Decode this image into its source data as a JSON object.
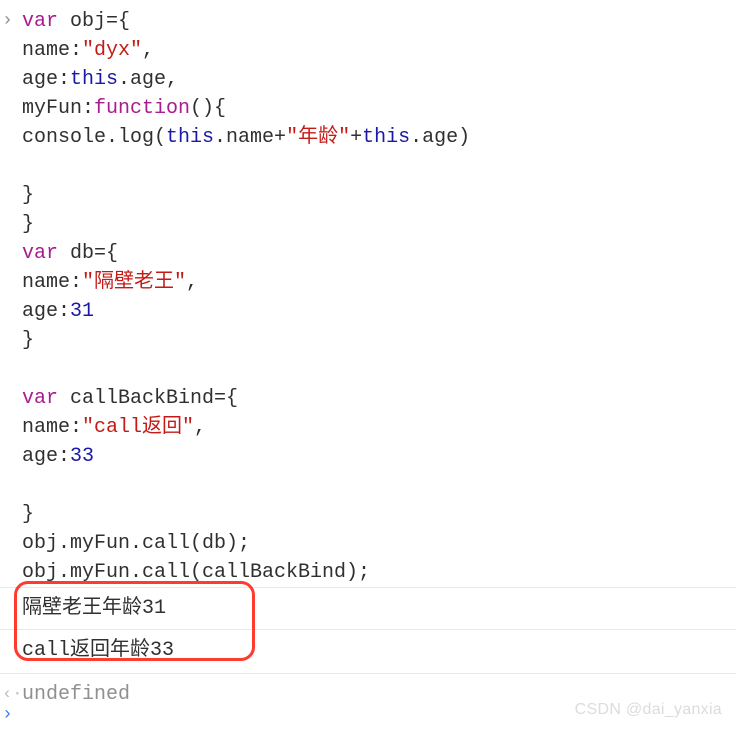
{
  "code": {
    "l1": {
      "a": "var",
      "b": " obj={"
    },
    "l2": {
      "a": "name:",
      "b": "\"dyx\"",
      "c": ","
    },
    "l3": {
      "a": "age:",
      "b": "this",
      "c": ".age,"
    },
    "l4": {
      "a": "myFun:",
      "b": "function",
      "c": "(){"
    },
    "l5": {
      "a": "console.log(",
      "b": "this",
      "c": ".name+",
      "d": "\"年龄\"",
      "e": "+",
      "f": "this",
      "g": ".age)"
    },
    "l6": "",
    "l7": "}",
    "l8": "}",
    "l9": {
      "a": "var",
      "b": " db={"
    },
    "l10": {
      "a": "name:",
      "b": "\"隔壁老王\"",
      "c": ","
    },
    "l11": {
      "a": "age:",
      "b": "31"
    },
    "l12": "}",
    "l13": "",
    "l14": {
      "a": "var",
      "b": " callBackBind={"
    },
    "l15": {
      "a": "name:",
      "b": "\"call返回\"",
      "c": ","
    },
    "l16": {
      "a": "age:",
      "b": "33"
    },
    "l17": "",
    "l18": "}",
    "l19": "obj.myFun.call(db);",
    "l20": "obj.myFun.call(callBackBind);"
  },
  "output": {
    "line1": "隔壁老王年龄31",
    "line2": "call返回年龄33"
  },
  "return_value": "undefined",
  "prompts": {
    "in": "›",
    "out": "‹·",
    "next": "›"
  },
  "watermark": "CSDN @dai_yanxia",
  "colors": {
    "highlight_border": "#ff3b30",
    "keyword": "#a71d8e",
    "string": "#c41a16",
    "identifier": "#1a1aa6"
  }
}
